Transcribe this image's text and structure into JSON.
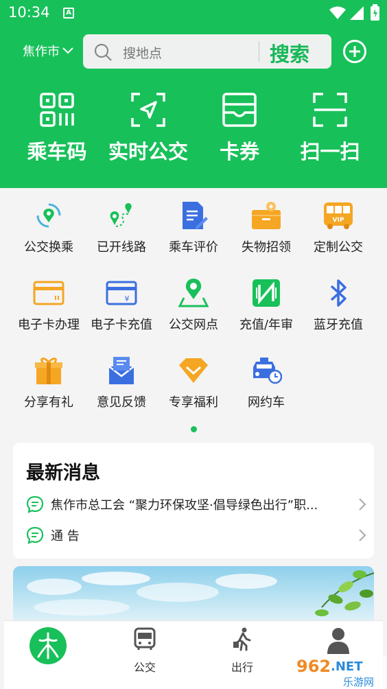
{
  "status_bar": {
    "time": "10:34",
    "sim_label": "A"
  },
  "header": {
    "city": "焦作市",
    "search_placeholder": "搜地点",
    "search_button": "搜索"
  },
  "quick_actions": [
    {
      "label": "乘车码",
      "icon": "qr-code-icon"
    },
    {
      "label": "实时公交",
      "icon": "navigation-arrow-icon"
    },
    {
      "label": "卡券",
      "icon": "card-coupon-icon"
    },
    {
      "label": "扫一扫",
      "icon": "scan-icon"
    }
  ],
  "services": [
    {
      "label": "公交换乘",
      "icon": "transfer-location-icon"
    },
    {
      "label": "已开线路",
      "icon": "route-icon"
    },
    {
      "label": "乘车评价",
      "icon": "review-document-icon"
    },
    {
      "label": "失物招领",
      "icon": "lost-found-box-icon"
    },
    {
      "label": "定制公交",
      "icon": "vip-bus-icon"
    },
    {
      "label": "电子卡办理",
      "icon": "e-card-icon"
    },
    {
      "label": "电子卡充值",
      "icon": "card-recharge-icon"
    },
    {
      "label": "公交网点",
      "icon": "service-point-icon"
    },
    {
      "label": "充值/年审",
      "icon": "nfc-icon"
    },
    {
      "label": "蓝牙充值",
      "icon": "bluetooth-icon"
    },
    {
      "label": "分享有礼",
      "icon": "gift-icon"
    },
    {
      "label": "意见反馈",
      "icon": "feedback-mail-icon"
    },
    {
      "label": "专享福利",
      "icon": "diamond-welfare-icon"
    },
    {
      "label": "网约车",
      "icon": "ride-hailing-car-icon"
    }
  ],
  "news": {
    "title": "最新消息",
    "items": [
      {
        "text": "焦作市总工会 “聚力环保攻坚·倡导绿色出行”职..."
      },
      {
        "text": "通 告"
      }
    ]
  },
  "tabbar": {
    "items": [
      {
        "label": "",
        "icon": "home-logo-icon"
      },
      {
        "label": "公交",
        "icon": "bus-icon"
      },
      {
        "label": "出行",
        "icon": "walking-person-icon"
      },
      {
        "label": "",
        "icon": "profile-icon"
      }
    ]
  },
  "watermark": {
    "text": "962.NET",
    "subtext": "乐游网"
  },
  "colors": {
    "brand_green": "#18c05a",
    "orange": "#f5a623",
    "blue": "#3b6fe0"
  }
}
